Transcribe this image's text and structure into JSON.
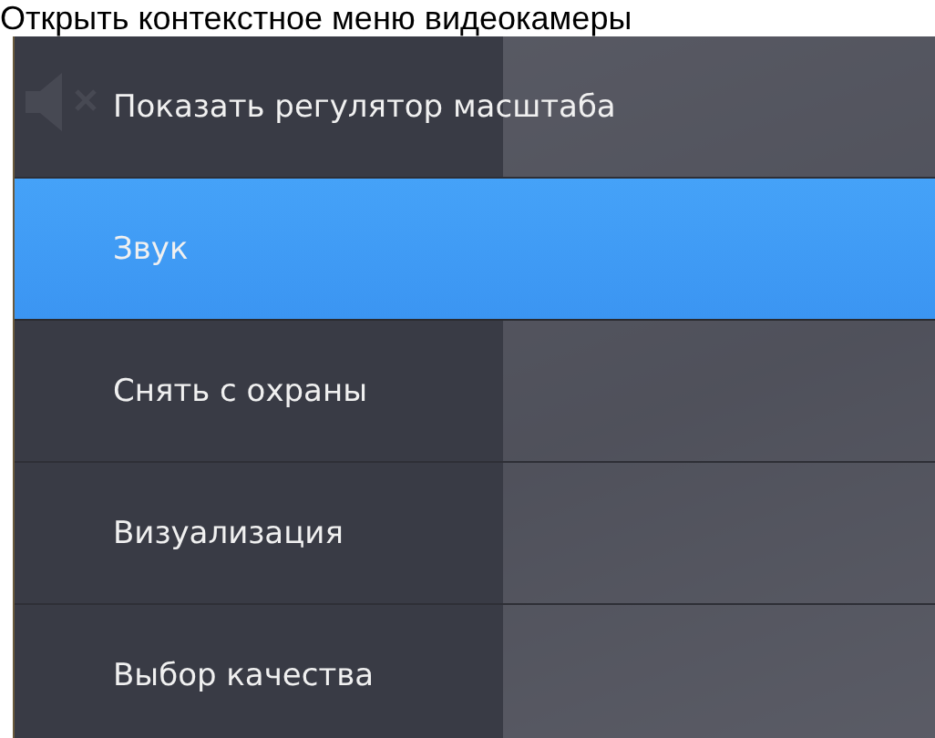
{
  "caption": "Открыть контекстное меню видеокамеры",
  "video": {
    "muted": true
  },
  "menu": [
    {
      "label": "Показать регулятор масштаба",
      "selected": false
    },
    {
      "label": "Звук",
      "selected": true
    },
    {
      "label": "Снять с охраны",
      "selected": false
    },
    {
      "label": "Визуализация",
      "selected": false
    },
    {
      "label": "Выбор качества",
      "selected": false
    }
  ]
}
